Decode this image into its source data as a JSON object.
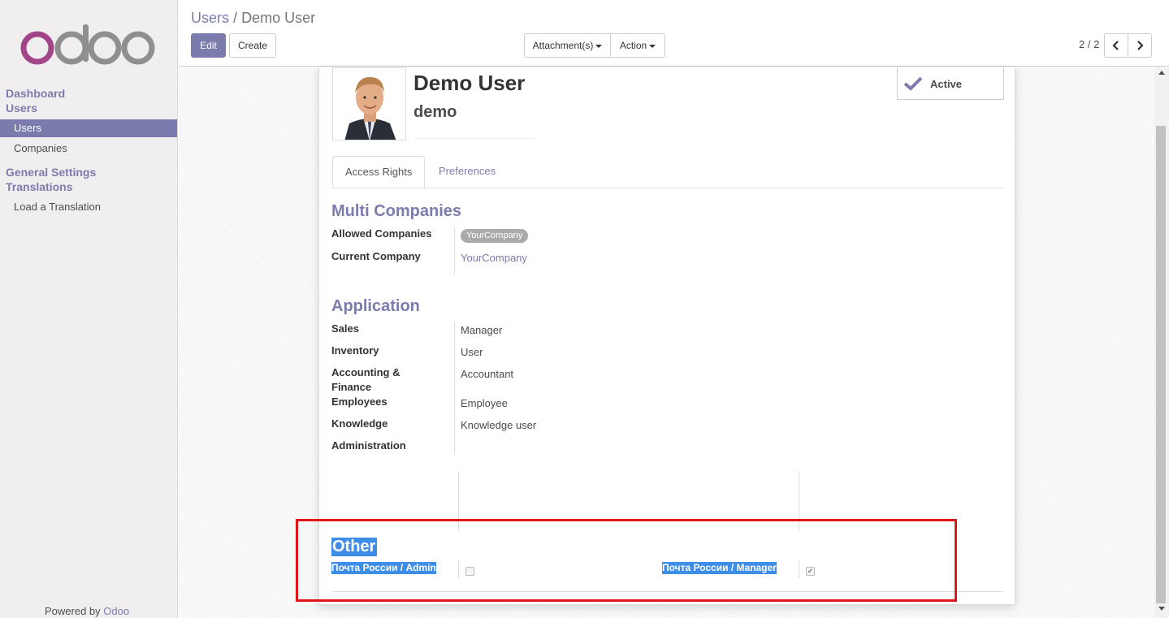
{
  "sidebar": {
    "menus": [
      {
        "header": "Dashboard"
      },
      {
        "header": "Users"
      },
      {
        "item": "Users",
        "active": true
      },
      {
        "item": "Companies"
      },
      {
        "header": "General Settings"
      },
      {
        "header": "Translations"
      },
      {
        "item": "Load a Translation"
      }
    ],
    "powered_prefix": "Powered by",
    "powered_brand": "Odoo"
  },
  "breadcrumb": {
    "parent": "Users",
    "separator": "/",
    "current": "Demo User"
  },
  "toolbar": {
    "edit_label": "Edit",
    "create_label": "Create",
    "attachments_label": "Attachment(s)",
    "action_label": "Action",
    "pager_value": "2 / 2"
  },
  "record": {
    "name": "Demo User",
    "login": "demo",
    "active_label": "Active"
  },
  "tabs": [
    "Access Rights",
    "Preferences"
  ],
  "multi_companies": {
    "title": "Multi Companies",
    "allowed_label": "Allowed Companies",
    "allowed_value": "YourCompany",
    "current_label": "Current Company",
    "current_value": "YourCompany"
  },
  "application": {
    "title": "Application",
    "rows": [
      {
        "label": "Sales",
        "value": "Manager"
      },
      {
        "label": "Inventory",
        "value": "User"
      },
      {
        "label": "Accounting & Finance",
        "value": "Accountant"
      },
      {
        "label": "Employees",
        "value": "Employee"
      },
      {
        "label": "Knowledge",
        "value": "Knowledge user"
      },
      {
        "label": "Administration",
        "value": ""
      }
    ]
  },
  "other": {
    "title": "Other",
    "admin_label": "Почта России / Admin",
    "admin_checked": false,
    "manager_label": "Почта России / Manager",
    "manager_checked": true
  },
  "colors": {
    "brand": "#7c7bad",
    "highlight": "#3e8ee9",
    "annotation": "#e0161b"
  }
}
